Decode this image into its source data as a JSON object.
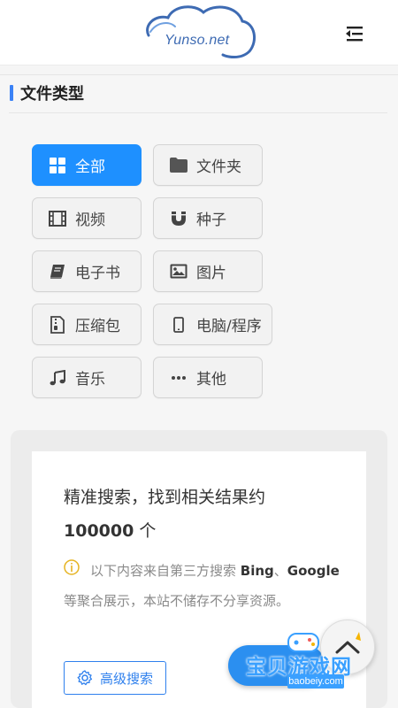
{
  "header": {
    "logo_text": "Yunso.net",
    "menu_icon": "menu-fold-icon"
  },
  "file_types": {
    "title": "文件类型",
    "items": [
      {
        "label": "全部",
        "icon": "grid-icon",
        "active": true
      },
      {
        "label": "文件夹",
        "icon": "folder-icon",
        "active": false
      },
      {
        "label": "视频",
        "icon": "film-icon",
        "active": false
      },
      {
        "label": "种子",
        "icon": "magnet-icon",
        "active": false
      },
      {
        "label": "电子书",
        "icon": "book-icon",
        "active": false
      },
      {
        "label": "图片",
        "icon": "image-icon",
        "active": false
      },
      {
        "label": "压缩包",
        "icon": "archive-icon",
        "active": false
      },
      {
        "label": "电脑/程序",
        "icon": "mobile-icon",
        "active": false
      },
      {
        "label": "音乐",
        "icon": "music-icon",
        "active": false
      },
      {
        "label": "其他",
        "icon": "ellipsis-icon",
        "active": false
      }
    ]
  },
  "results": {
    "summary_prefix": "精准搜索，找到相关结果约",
    "count": "100000",
    "unit": " 个",
    "notice_part1": "以下内容来自第三方搜索 ",
    "notice_bing": "Bing",
    "notice_sep": "、",
    "notice_google": "Google",
    "notice_part2": "等聚合展示，本站不储存不分享资源。"
  },
  "advanced_search": {
    "label": "高级搜索",
    "icon": "gear-icon"
  },
  "overlay": {
    "watermark_text": "宝贝游戏网",
    "watermark_url": "baobeiy.com",
    "back_to_top_icon": "chevron-up-icon",
    "accent": "#1e90ff"
  }
}
